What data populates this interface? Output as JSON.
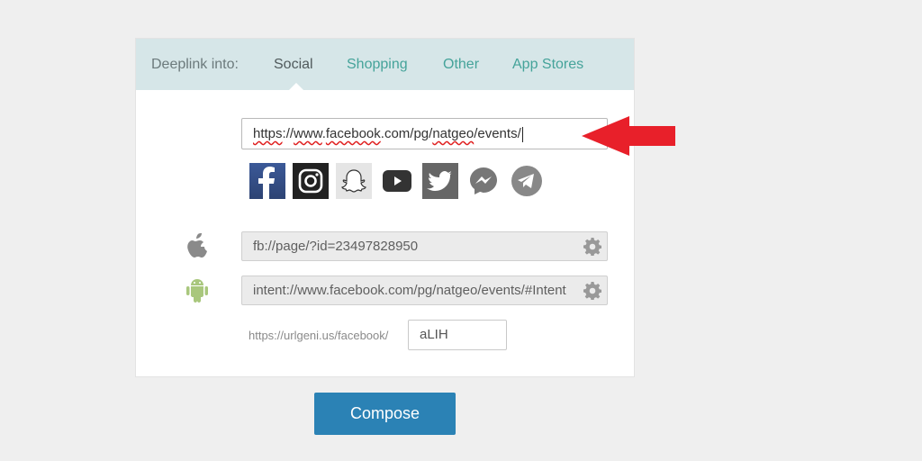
{
  "tabs": {
    "label": "Deeplink into:",
    "items": [
      "Social",
      "Shopping",
      "Other",
      "App Stores"
    ],
    "active": "Social"
  },
  "url_input": {
    "parts": [
      "https",
      "://",
      "www",
      ".",
      "facebook",
      ".com/pg/",
      "natgeo",
      "/events/"
    ]
  },
  "social_icons": [
    "facebook-icon",
    "instagram-icon",
    "snapchat-icon",
    "youtube-icon",
    "twitter-icon",
    "messenger-icon",
    "telegram-icon"
  ],
  "ios_link": {
    "icon": "apple-icon",
    "value": "fb://page/?id=23497828950"
  },
  "android_link": {
    "icon": "android-icon",
    "value": "intent://www.facebook.com/pg/natgeo/events/#Intent"
  },
  "short_link": {
    "prefix": "https://urlgeni.us/facebook/",
    "alias": "aLIH"
  },
  "compose_label": "Compose",
  "colors": {
    "tab_active": "#505a5c",
    "tab_link": "#45a39a",
    "tab_bar_bg": "#d6e6e8",
    "compose_bg": "#2b82b5",
    "arrow": "#e8202a"
  }
}
